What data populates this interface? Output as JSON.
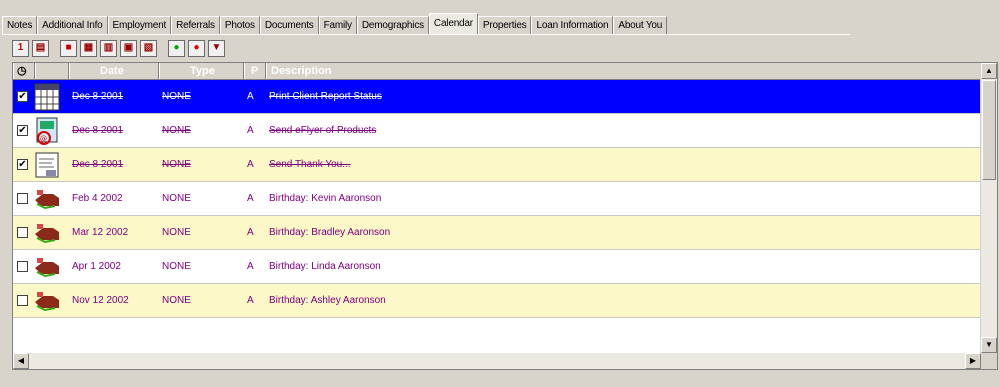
{
  "tabs": [
    "Notes",
    "Additional Info",
    "Employment",
    "Referrals",
    "Photos",
    "Documents",
    "Family",
    "Demographics",
    "Calendar",
    "Properties",
    "Loan Information",
    "About You"
  ],
  "active_tab": "Calendar",
  "toolbar": {
    "buttons": [
      "1",
      "a",
      "b",
      "c",
      "d",
      "e",
      "f",
      "g",
      "h"
    ]
  },
  "grid": {
    "columns": [
      "Date",
      "Type",
      "P",
      "Description"
    ],
    "rows": [
      {
        "checked": true,
        "icon": "calendar-grid-icon",
        "date": "Dec 8 2001",
        "type": "NONE",
        "p": "A",
        "desc": "Print Client Report Status",
        "selected": true,
        "struck": true
      },
      {
        "checked": true,
        "icon": "flyer-icon",
        "date": "Dec 8 2001",
        "type": "NONE",
        "p": "A",
        "desc": "Send eFlyer of Products",
        "selected": false,
        "struck": true
      },
      {
        "checked": true,
        "icon": "thank-you-icon",
        "date": "Dec 8 2001",
        "type": "NONE",
        "p": "A",
        "desc": "Send Thank You...",
        "selected": false,
        "struck": true
      },
      {
        "checked": false,
        "icon": "birthday-icon",
        "date": "Feb 4 2002",
        "type": "NONE",
        "p": "A",
        "desc": "Birthday: Kevin Aaronson",
        "selected": false,
        "struck": false
      },
      {
        "checked": false,
        "icon": "birthday-icon",
        "date": "Mar 12 2002",
        "type": "NONE",
        "p": "A",
        "desc": "Birthday: Bradley Aaronson",
        "selected": false,
        "struck": false
      },
      {
        "checked": false,
        "icon": "birthday-icon",
        "date": "Apr 1 2002",
        "type": "NONE",
        "p": "A",
        "desc": "Birthday: Linda Aaronson",
        "selected": false,
        "struck": false
      },
      {
        "checked": false,
        "icon": "birthday-icon",
        "date": "Nov 12 2002",
        "type": "NONE",
        "p": "A",
        "desc": "Birthday: Ashley Aaronson",
        "selected": false,
        "struck": false
      }
    ]
  },
  "colors": {
    "selection": "#0000ff",
    "alt_row": "#fdf8c8",
    "text": "#800080"
  }
}
